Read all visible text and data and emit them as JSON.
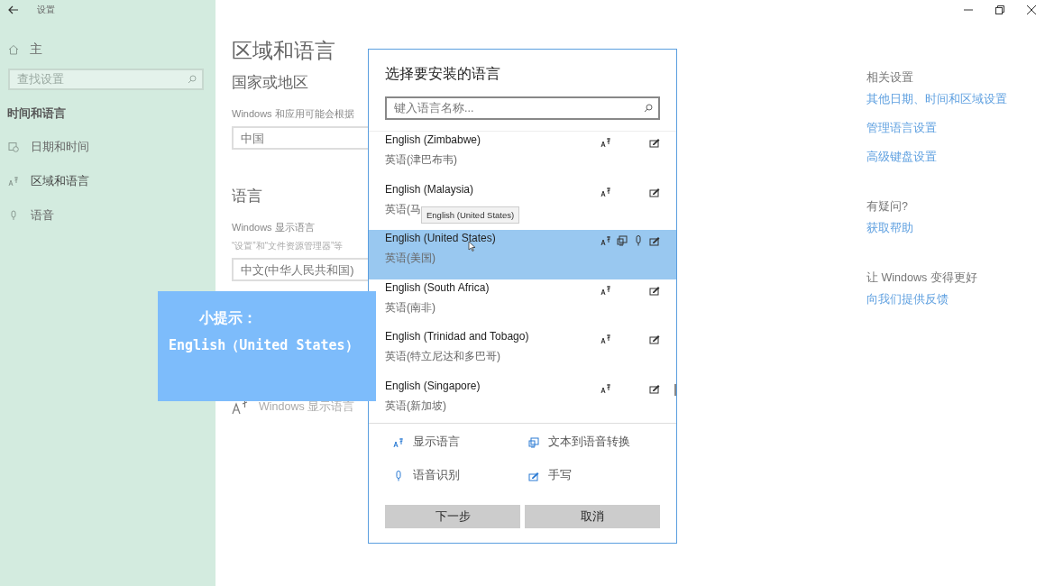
{
  "window": {
    "title": "设置"
  },
  "sidebar": {
    "home_label": "主",
    "search": {
      "placeholder": "查找设置"
    },
    "section": "时间和语言",
    "items": [
      {
        "label": "日期和时间",
        "selected": false
      },
      {
        "label": "区域和语言",
        "selected": true
      },
      {
        "label": "语音",
        "selected": false
      }
    ]
  },
  "main": {
    "title": "区域和语言",
    "region_heading": "国家或地区",
    "region_description": "Windows 和应用可能会根据",
    "region_value": "中国",
    "language_heading": "语言",
    "display_language_label": "Windows 显示语言",
    "display_language_description": "“设置”和“文件资源管理器”等",
    "display_language_value": "中文(中华人民共和国)",
    "installed_language_caption": "Windows 显示语言"
  },
  "related": {
    "heading": "相关设置",
    "links": [
      "其他日期、时间和区域设置",
      "管理语言设置",
      "高级键盘设置"
    ],
    "help_heading": "有疑问?",
    "help_link": "获取帮助",
    "feedback_heading": "让 Windows 变得更好",
    "feedback_link": "向我们提供反馈"
  },
  "dialog": {
    "title": "选择要安装的语言",
    "search": {
      "placeholder": "键入语言名称..."
    },
    "languages": [
      {
        "name": "English (Zimbabwe)",
        "native": "英语(津巴布韦)",
        "selected": false,
        "display": true,
        "tts": false,
        "speech": false,
        "handwriting": true
      },
      {
        "name": "English (Malaysia)",
        "native": "英语(马",
        "tooltip": "English (United States)",
        "selected": false,
        "display": true,
        "tts": false,
        "speech": false,
        "handwriting": true
      },
      {
        "name": "English (United States)",
        "native": "英语(美国)",
        "selected": true,
        "display": true,
        "tts": true,
        "speech": true,
        "handwriting": true
      },
      {
        "name": "English (South Africa)",
        "native": "英语(南非)",
        "selected": false,
        "display": true,
        "tts": false,
        "speech": false,
        "handwriting": true
      },
      {
        "name": "English (Trinidad and Tobago)",
        "native": "英语(特立尼达和多巴哥)",
        "selected": false,
        "display": true,
        "tts": false,
        "speech": false,
        "handwriting": true
      },
      {
        "name": "English (Singapore)",
        "native": "英语(新加坡)",
        "selected": false,
        "display": true,
        "tts": false,
        "speech": false,
        "handwriting": true
      }
    ],
    "legend": [
      {
        "kind": "display",
        "label": "显示语言"
      },
      {
        "kind": "tts",
        "label": "文本到语音转换"
      },
      {
        "kind": "speech",
        "label": "语音识别"
      },
      {
        "kind": "handwriting",
        "label": "手写"
      }
    ],
    "buttons": [
      "下一步",
      "取消"
    ]
  },
  "tip": {
    "title": "小提示：",
    "text": "English（United States）"
  }
}
